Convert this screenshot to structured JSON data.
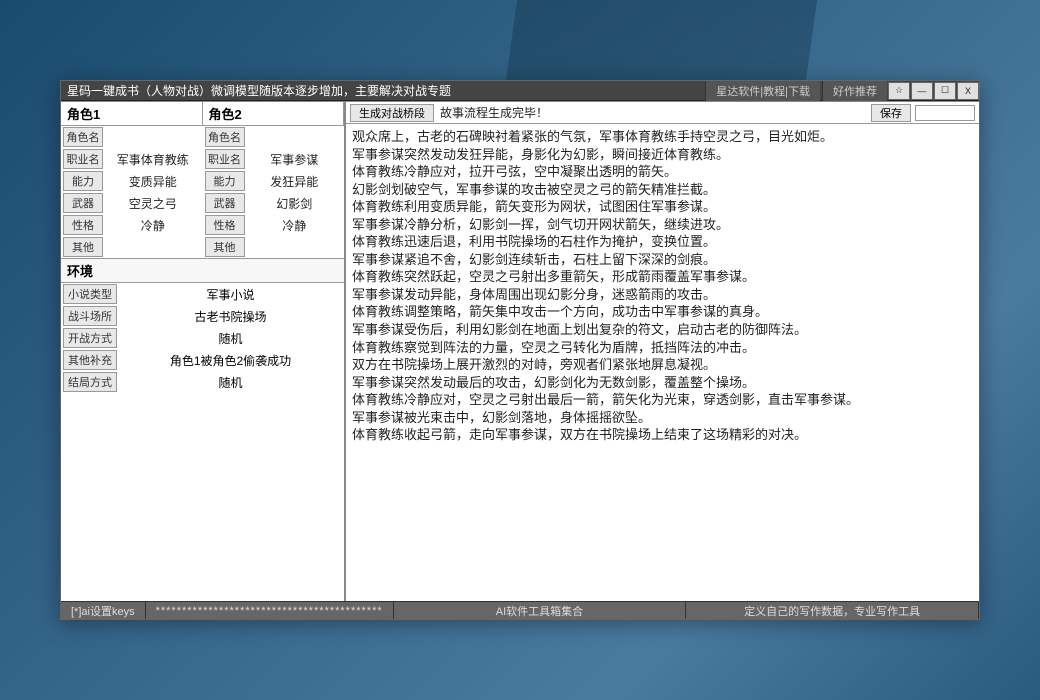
{
  "titlebar": {
    "title": "星码一键成书（人物对战）微调模型随版本逐步增加，主要解决对战专题",
    "tab1": "星达软件|教程|下载",
    "tab2": "好作推荐"
  },
  "winControls": {
    "fav": "☆",
    "min": "—",
    "max": "☐",
    "close": "X"
  },
  "roles": {
    "header1": "角色1",
    "header2": "角色2",
    "fields": [
      "角色名",
      "职业名",
      "能力",
      "武器",
      "性格",
      "其他"
    ],
    "role1": {
      "角色名": "",
      "职业名": "军事体育教练",
      "能力": "变质异能",
      "武器": "空灵之弓",
      "性格": "冷静",
      "其他": ""
    },
    "role2": {
      "角色名": "",
      "职业名": "军事参谋",
      "能力": "发狂异能",
      "武器": "幻影剑",
      "性格": "冷静",
      "其他": ""
    }
  },
  "env": {
    "header": "环境",
    "rows": [
      {
        "label": "小说类型",
        "value": "军事小说"
      },
      {
        "label": "战斗场所",
        "value": "古老书院操场"
      },
      {
        "label": "开战方式",
        "value": "随机"
      },
      {
        "label": "其他补充",
        "value": "角色1被角色2偷袭成功"
      },
      {
        "label": "结局方式",
        "value": "随机"
      }
    ]
  },
  "toolbar": {
    "generate": "生成对战桥段",
    "status": "故事流程生成完毕！",
    "save": "保存"
  },
  "story": "观众席上，古老的石碑映衬着紧张的气氛，军事体育教练手持空灵之弓，目光如炬。\n军事参谋突然发动发狂异能，身影化为幻影，瞬间接近体育教练。\n体育教练冷静应对，拉开弓弦，空中凝聚出透明的箭矢。\n幻影剑划破空气，军事参谋的攻击被空灵之弓的箭矢精准拦截。\n体育教练利用变质异能，箭矢变形为网状，试图困住军事参谋。\n军事参谋冷静分析，幻影剑一挥，剑气切开网状箭矢，继续进攻。\n体育教练迅速后退，利用书院操场的石柱作为掩护，变换位置。\n军事参谋紧追不舍，幻影剑连续斩击，石柱上留下深深的剑痕。\n体育教练突然跃起，空灵之弓射出多重箭矢，形成箭雨覆盖军事参谋。\n军事参谋发动异能，身体周围出现幻影分身，迷惑箭雨的攻击。\n体育教练调整策略，箭矢集中攻击一个方向，成功击中军事参谋的真身。\n军事参谋受伤后，利用幻影剑在地面上划出复杂的符文，启动古老的防御阵法。\n体育教练察觉到阵法的力量，空灵之弓转化为盾牌，抵挡阵法的冲击。\n双方在书院操场上展开激烈的对峙，旁观者们紧张地屏息凝视。\n军事参谋突然发动最后的攻击，幻影剑化为无数剑影，覆盖整个操场。\n体育教练冷静应对，空灵之弓射出最后一箭，箭矢化为光束，穿透剑影，直击军事参谋。\n军事参谋被光束击中，幻影剑落地，身体摇摇欲坠。\n体育教练收起弓箭，走向军事参谋，双方在书院操场上结束了这场精彩的对决。",
  "footer": {
    "keys": "[*]ai设置keys",
    "stars": "*******************************************",
    "mid": "AI软件工具箱集合",
    "right": "定义自己的写作数据，专业写作工具"
  }
}
